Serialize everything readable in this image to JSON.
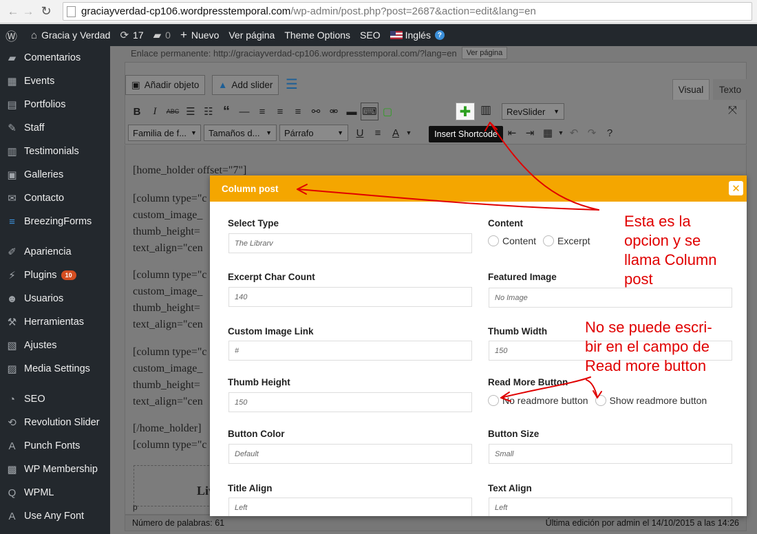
{
  "browser": {
    "url_host": "graciayverdad-cp106.wordpresstemporal.com",
    "url_path": "/wp-admin/post.php?post=2687&action=edit&lang=en"
  },
  "adminbar": {
    "site_name": "Gracia y Verdad",
    "updates_count": "17",
    "comments_count": "0",
    "new_label": "Nuevo",
    "view_page": "Ver página",
    "theme_options": "Theme Options",
    "seo": "SEO",
    "language": "Inglés"
  },
  "sidebar": {
    "items": [
      {
        "label": "Comentarios"
      },
      {
        "label": "Events"
      },
      {
        "label": "Portfolios"
      },
      {
        "label": "Staff"
      },
      {
        "label": "Testimonials"
      },
      {
        "label": "Galleries"
      },
      {
        "label": "Contacto"
      },
      {
        "label": "BreezingForms"
      },
      {
        "label": "Apariencia"
      },
      {
        "label": "Plugins",
        "badge": "10"
      },
      {
        "label": "Usuarios"
      },
      {
        "label": "Herramientas"
      },
      {
        "label": "Ajustes"
      },
      {
        "label": "Media Settings"
      },
      {
        "label": "SEO"
      },
      {
        "label": "Revolution Slider"
      },
      {
        "label": "Punch Fonts"
      },
      {
        "label": "WP Membership"
      },
      {
        "label": "WPML"
      },
      {
        "label": "Use Any Font"
      }
    ]
  },
  "permalink": {
    "text": "Enlace permanente: http://graciayverdad-cp106.wordpresstemporal.com/?lang=en",
    "button": "Ver página"
  },
  "editor": {
    "add_media": "Añadir objeto",
    "add_slider": "Add slider",
    "tab_visual": "Visual",
    "tab_text": "Texto",
    "revslider": "RevSlider",
    "font_family": "Familia de f...",
    "font_size": "Tamaños d...",
    "format": "Párrafo",
    "tooltip": "Insert Shortcode",
    "lines": [
      "[home_holder offset=\"7\"]",
      "[column type=\"c",
      "custom_image_",
      "thumb_height=",
      "text_align=\"cen",
      "[column type=\"c",
      "custom_image_",
      "thumb_height=",
      "text_align=\"cen",
      "[column type=\"c",
      "custom_image_",
      "thumb_height=",
      "text_align=\"cen",
      "[/home_holder]",
      "[column type=\"c"
    ],
    "live_text": "Liv",
    "p_tag": "p",
    "word_count": "Número de palabras: 61",
    "last_edit": "Última edición por admin el 14/10/2015 a las 14:26"
  },
  "modal": {
    "title": "Column post",
    "close_icon": "✕",
    "fields": {
      "select_type": {
        "label": "Select Type",
        "placeholder": "The Librarv"
      },
      "content": {
        "label": "Content",
        "options": [
          "Content",
          "Excerpt"
        ]
      },
      "excerpt_count": {
        "label": "Excerpt Char Count",
        "placeholder": "140"
      },
      "featured_image": {
        "label": "Featured Image",
        "placeholder": "No Image"
      },
      "custom_link": {
        "label": "Custom Image Link",
        "placeholder": "#"
      },
      "thumb_width": {
        "label": "Thumb Width",
        "placeholder": "150"
      },
      "thumb_height": {
        "label": "Thumb Height",
        "placeholder": "150"
      },
      "read_more": {
        "label": "Read More Button",
        "options": [
          "No readmore button",
          "Show readmore button"
        ]
      },
      "button_color": {
        "label": "Button Color",
        "placeholder": "Default"
      },
      "button_size": {
        "label": "Button Size",
        "placeholder": "Small"
      },
      "title_align": {
        "label": "Title Align",
        "placeholder": "Left"
      },
      "text_align": {
        "label": "Text Align",
        "placeholder": "Left"
      }
    }
  },
  "annotations": {
    "note1": [
      "Esta es la",
      "opcion y se",
      "llama Column",
      "post"
    ],
    "note2": [
      "No se puede escri-",
      "bir en el campo de",
      "Read more button"
    ]
  },
  "colors": {
    "modal_header": "#f4a600",
    "annotation": "#e00000",
    "admin_dark": "#23282d"
  }
}
